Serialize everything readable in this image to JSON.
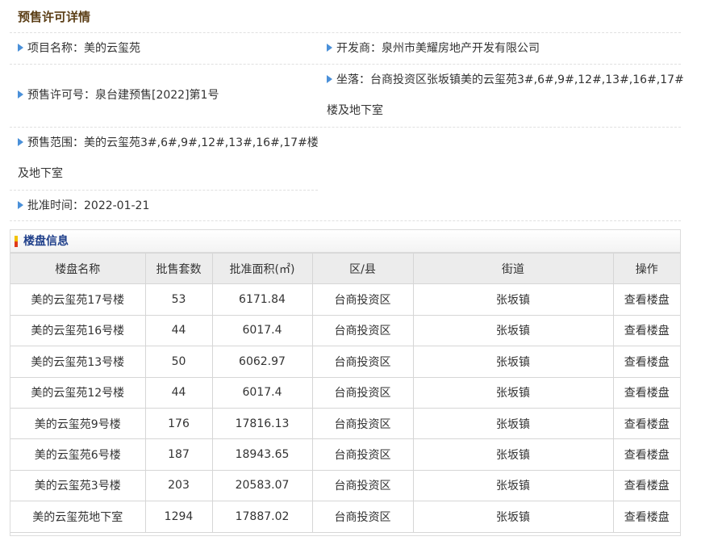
{
  "page": {
    "title": "预售许可详情"
  },
  "permit": {
    "project_name": {
      "label": "项目名称：",
      "value": "美的云玺苑"
    },
    "developer": {
      "label": "开发商：",
      "value": "泉州市美耀房地产开发有限公司"
    },
    "permit_no": {
      "label": "预售许可号：",
      "value": "泉台建预售[2022]第1号"
    },
    "location": {
      "label": "坐落：",
      "value": "台商投资区张坂镇美的云玺苑3#,6#,9#,12#,13#,16#,17#",
      "value_line2": "楼及地下室"
    },
    "scope": {
      "label": "预售范围：",
      "value": "美的云玺苑3#,6#,9#,12#,13#,16#,17#楼",
      "value_line2": "及地下室"
    },
    "approval_date": {
      "label": "批准时间：",
      "value": "2022-01-21"
    }
  },
  "buildings": {
    "title": "楼盘信息",
    "columns": [
      "楼盘名称",
      "批售套数",
      "批准面积(㎡)",
      "区/县",
      "街道",
      "操作"
    ],
    "rows": [
      [
        "美的云玺苑17号楼",
        "53",
        "6171.84",
        "台商投资区",
        "张坂镇",
        "查看楼盘"
      ],
      [
        "美的云玺苑16号楼",
        "44",
        "6017.4",
        "台商投资区",
        "张坂镇",
        "查看楼盘"
      ],
      [
        "美的云玺苑13号楼",
        "50",
        "6062.97",
        "台商投资区",
        "张坂镇",
        "查看楼盘"
      ],
      [
        "美的云玺苑12号楼",
        "44",
        "6017.4",
        "台商投资区",
        "张坂镇",
        "查看楼盘"
      ],
      [
        "美的云玺苑9号楼",
        "176",
        "17816.13",
        "台商投资区",
        "张坂镇",
        "查看楼盘"
      ],
      [
        "美的云玺苑6号楼",
        "187",
        "18943.65",
        "台商投资区",
        "张坂镇",
        "查看楼盘"
      ],
      [
        "美的云玺苑3号楼",
        "203",
        "20583.07",
        "台商投资区",
        "张坂镇",
        "查看楼盘"
      ],
      [
        "美的云玺苑地下室",
        "1294",
        "17887.02",
        "台商投资区",
        "张坂镇",
        "查看楼盘"
      ]
    ]
  },
  "colors": {
    "title": "#5b3e16",
    "arrow": "#4a90d9",
    "panel_title": "#1f3f8a",
    "header_bg": "#ececec"
  },
  "icons": {
    "bullet": "triangle-right-icon",
    "panel_marker": "bar-marker-icon"
  }
}
